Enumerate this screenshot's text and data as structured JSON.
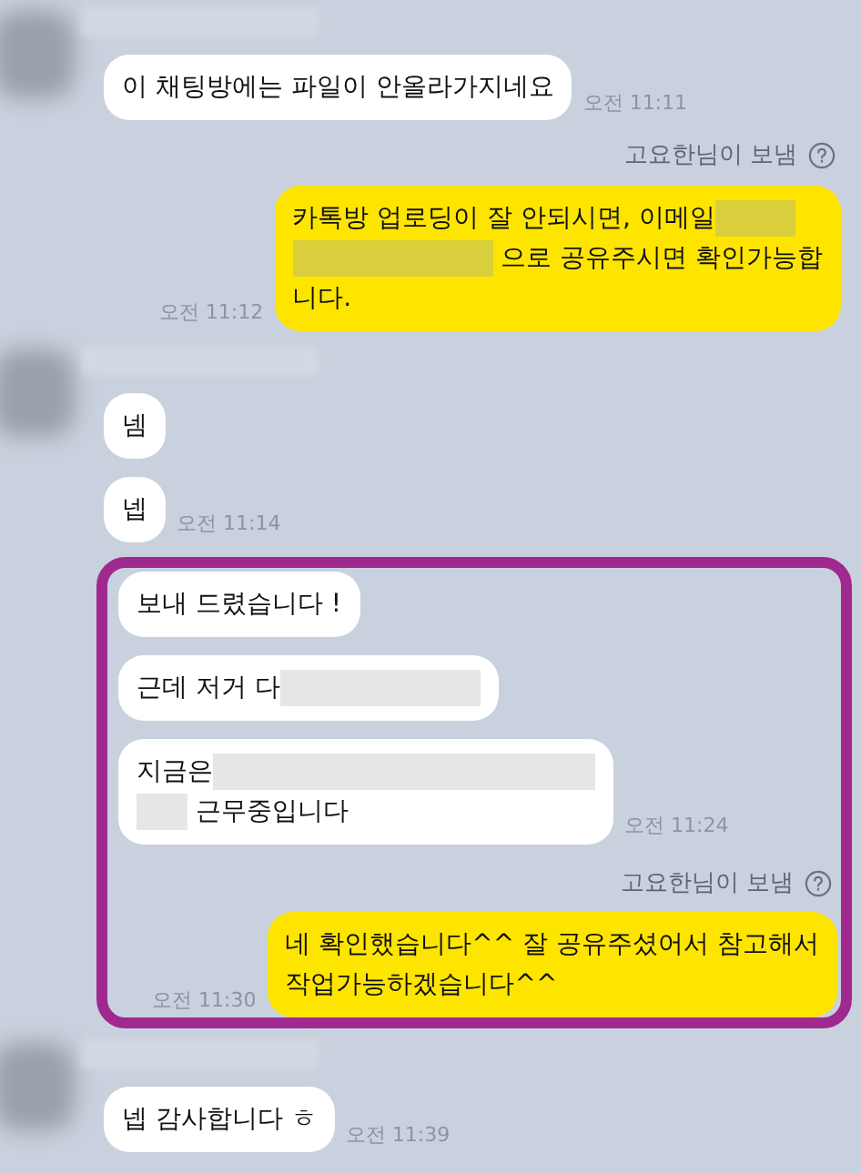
{
  "sections": [
    {
      "highlighted": false,
      "groups": [
        {
          "kind": "received",
          "avatar": true,
          "messages": [
            {
              "parts": [
                {
                  "kind": "text",
                  "text": "이 채팅방에는 파일이 안올라가지네요"
                }
              ],
              "time": "오전 11:11"
            }
          ]
        },
        {
          "kind": "sent",
          "note": "고요한님이 보냄",
          "messages": [
            {
              "parts": [
                {
                  "kind": "text",
                  "text": "카톡방 업로딩이 잘 안되시면, 이메일"
                },
                {
                  "kind": "blur_short"
                },
                {
                  "kind": "break"
                },
                {
                  "kind": "blur"
                },
                {
                  "kind": "text",
                  "text": " 으로 공유주시면 확인가능합"
                },
                {
                  "kind": "break"
                },
                {
                  "kind": "text",
                  "text": "니다."
                }
              ],
              "time": "오전 11:12"
            }
          ]
        },
        {
          "kind": "received",
          "avatar": true,
          "messages": [
            {
              "parts": [
                {
                  "kind": "text",
                  "text": "넴"
                }
              ]
            },
            {
              "parts": [
                {
                  "kind": "text",
                  "text": "넵"
                }
              ],
              "time": "오전 11:14"
            }
          ]
        }
      ]
    },
    {
      "highlighted": true,
      "groups": [
        {
          "kind": "received",
          "avatar": false,
          "messages": [
            {
              "parts": [
                {
                  "kind": "text",
                  "text": "보내 드렸습니다 !"
                }
              ]
            },
            {
              "parts": [
                {
                  "kind": "text",
                  "text": "근데 저거 다"
                },
                {
                  "kind": "blur"
                }
              ]
            },
            {
              "parts": [
                {
                  "kind": "text",
                  "text": "지금은"
                },
                {
                  "kind": "blur_long"
                },
                {
                  "kind": "break"
                },
                {
                  "kind": "blur_tiny"
                },
                {
                  "kind": "text",
                  "text": " 근무중입니다"
                }
              ],
              "time": "오전 11:24"
            }
          ]
        },
        {
          "kind": "sent",
          "note": "고요한님이 보냄",
          "messages": [
            {
              "parts": [
                {
                  "kind": "text",
                  "text": "네 확인했습니다^^ 잘 공유주셨어서 참고해서"
                },
                {
                  "kind": "break"
                },
                {
                  "kind": "text",
                  "text": "작업가능하겠습니다^^"
                }
              ],
              "time": "오전 11:30"
            }
          ]
        }
      ]
    },
    {
      "highlighted": false,
      "groups": [
        {
          "kind": "received",
          "avatar": true,
          "messages": [
            {
              "parts": [
                {
                  "kind": "text",
                  "text": "넵 감사합니다 ㅎ"
                }
              ],
              "time": "오전 11:39"
            }
          ]
        }
      ]
    }
  ]
}
